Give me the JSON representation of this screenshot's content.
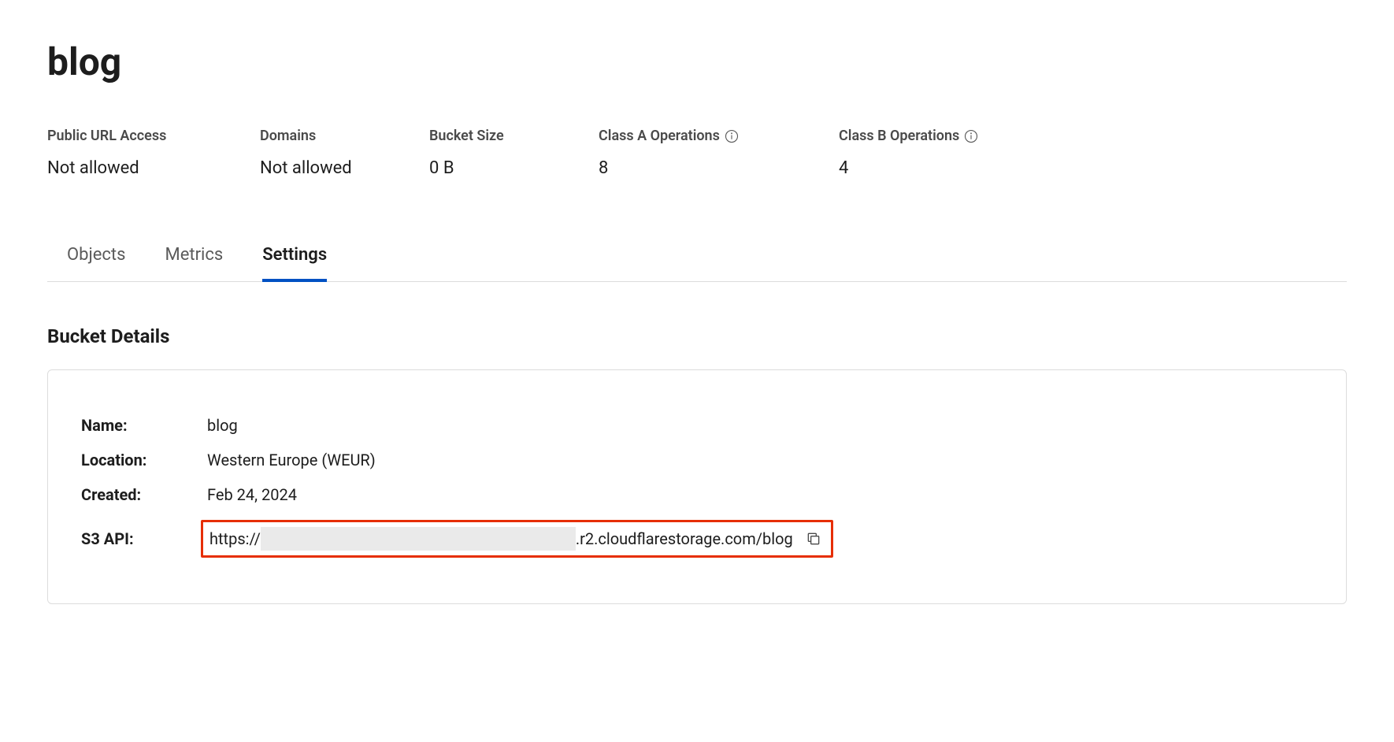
{
  "page": {
    "title": "blog"
  },
  "stats": [
    {
      "label": "Public URL Access",
      "value": "Not allowed",
      "info": false
    },
    {
      "label": "Domains",
      "value": "Not allowed",
      "info": false
    },
    {
      "label": "Bucket Size",
      "value": "0 B",
      "info": false
    },
    {
      "label": "Class A Operations",
      "value": "8",
      "info": true
    },
    {
      "label": "Class B Operations",
      "value": "4",
      "info": true
    }
  ],
  "tabs": [
    {
      "label": "Objects",
      "active": false
    },
    {
      "label": "Metrics",
      "active": false
    },
    {
      "label": "Settings",
      "active": true
    }
  ],
  "section": {
    "title": "Bucket Details"
  },
  "details": {
    "name_label": "Name:",
    "name_value": "blog",
    "location_label": "Location:",
    "location_value": "Western Europe (WEUR)",
    "created_label": "Created:",
    "created_value": "Feb 24, 2024",
    "s3api_label": "S3 API:",
    "s3api_prefix": "https://",
    "s3api_suffix": ".r2.cloudflarestorage.com/blog"
  }
}
